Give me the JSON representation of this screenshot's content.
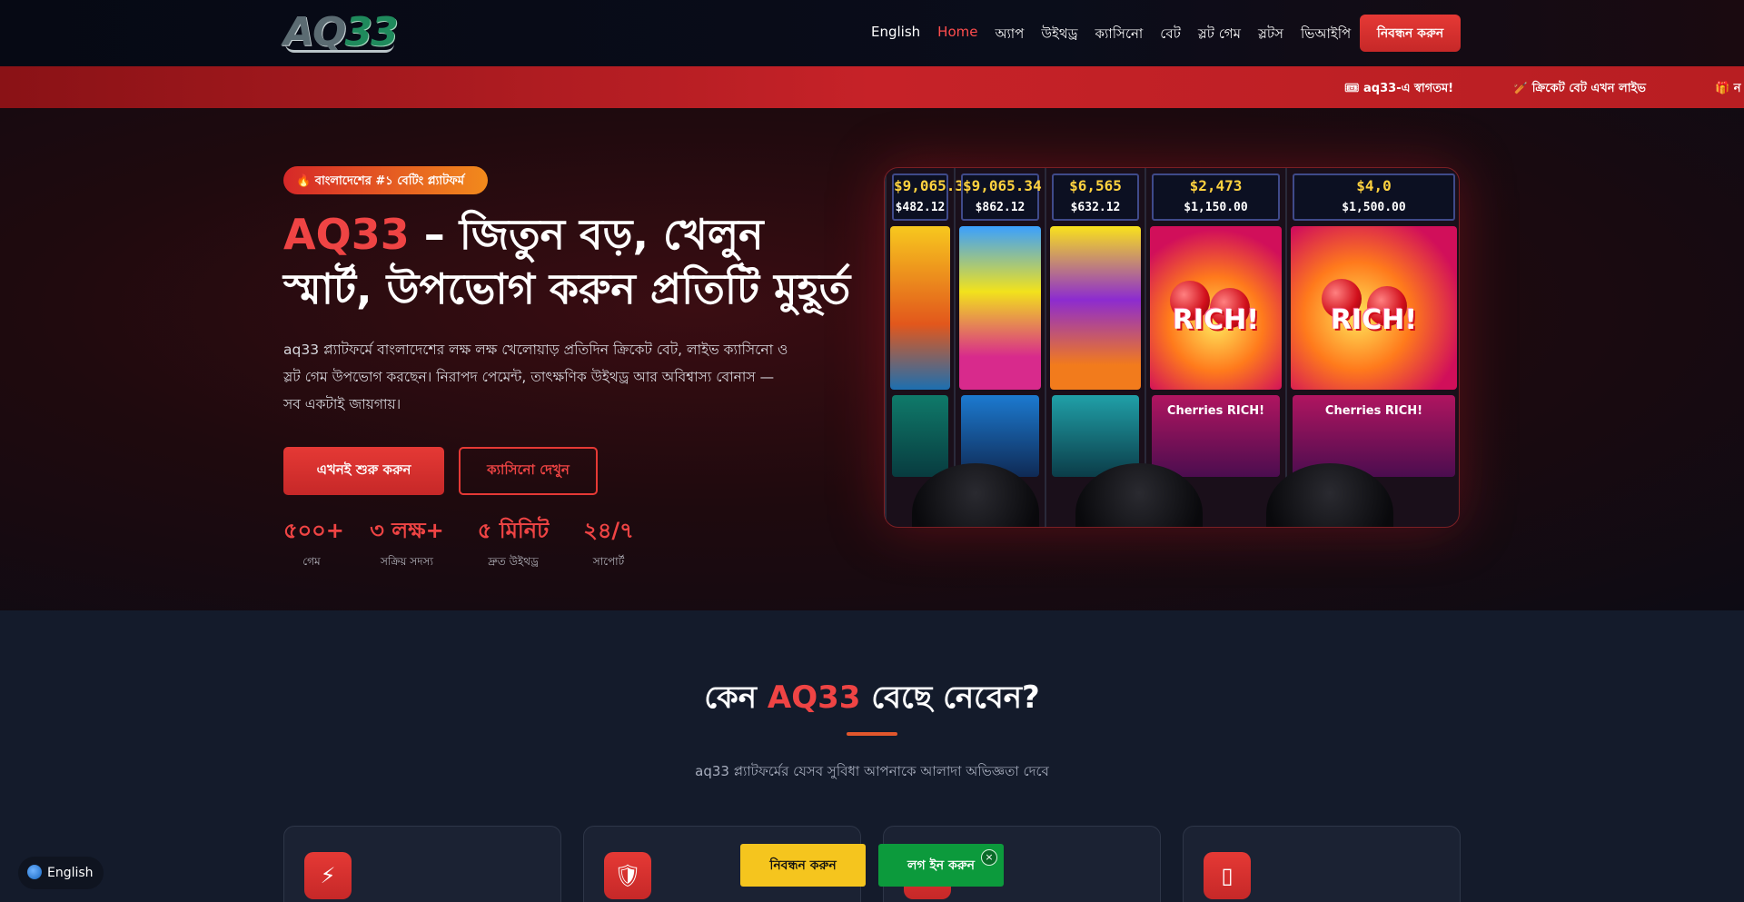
{
  "header": {
    "logo_aq": "AQ",
    "logo_num": "33",
    "nav": [
      {
        "label": "English",
        "active": false
      },
      {
        "label": "Home",
        "active": true
      },
      {
        "label": "অ্যাপ",
        "active": false
      },
      {
        "label": "উইথড্র",
        "active": false
      },
      {
        "label": "ক্যাসিনো",
        "active": false
      },
      {
        "label": "বেট",
        "active": false
      },
      {
        "label": "স্লট গেম",
        "active": false
      },
      {
        "label": "স্লটস",
        "active": false
      },
      {
        "label": "ভিআইপি",
        "active": false
      }
    ],
    "register_label": "নিবন্ধন করুন"
  },
  "ticker": {
    "items": [
      "🎟 aq33-এ স্বাগতম!",
      "🏏 ক্রিকেট বেট এখন লাইভ",
      "🎁 ন"
    ]
  },
  "hero": {
    "badge": "🔥 বাংলাদেশের #১ বেটিং প্ল্যাটফর্ম",
    "title_brand": "AQ33",
    "title_rest": " – জিতুন বড়, খেলুন স্মার্ট, উপভোগ করুন প্রতিটি মুহূর্ত",
    "description": "aq33 প্ল্যাটফর্মে বাংলাদেশের লক্ষ লক্ষ খেলোয়াড় প্রতিদিন ক্রিকেট বেট, লাইভ ক্যাসিনো ও স্লট গেম উপভোগ করছেন। নিরাপদ পেমেন্ট, তাৎক্ষণিক উইথড্র আর অবিশ্বাস্য বোনাস — সব একটাই জায়গায়।",
    "btn_start": "এখনই শুরু করুন",
    "btn_casino": "ক্যাসিনো দেখুন",
    "stats": [
      {
        "value": "৫০০+",
        "label": "গেম"
      },
      {
        "value": "৩ লক্ষ+",
        "label": "সক্রিয় সদস্য"
      },
      {
        "value": "৫ মিনিট",
        "label": "দ্রুত উইথড্র"
      },
      {
        "value": "২৪/৭",
        "label": "সাপোর্ট"
      }
    ],
    "slot_screens": [
      "$9,065.34",
      "$9,065.34",
      "$6,565",
      "$2,473",
      "$4,0"
    ],
    "slot_sub_screens": [
      "$482.12",
      "$862.12",
      "$632.12",
      "$1,150.00",
      "$1,500.00"
    ],
    "rich_words": [
      "",
      "",
      "",
      "RICH!",
      "RICH!"
    ],
    "lower_panel": [
      "",
      "",
      "",
      "Cherries RICH!",
      "Cherries RICH!"
    ]
  },
  "why": {
    "title_pre": "কেন ",
    "title_brand": "AQ33",
    "title_post": " বেছে নেবেন?",
    "subtitle": "aq33 প্ল্যাটফর্মের যেসব সুবিধা আপনাকে আলাদা অভিজ্ঞতা দেবে",
    "cards": [
      {
        "icon": "lightning-icon",
        "glyph": "⚡"
      },
      {
        "icon": "shield-icon",
        "glyph": "🛡"
      },
      {
        "icon": "card-icon",
        "glyph": ""
      },
      {
        "icon": "mobile-icon",
        "glyph": "▯"
      }
    ]
  },
  "floating": {
    "lang_label": "English",
    "register_label": "নিবন্ধন করুন",
    "login_label": "লগ ইন করুন",
    "close_glyph": "×"
  },
  "colors": {
    "accent": "#ef4444",
    "header_bg": "#060914",
    "ticker_bg": "#c62228",
    "float_register": "#f5c51e",
    "float_login": "#0c9a3c"
  }
}
